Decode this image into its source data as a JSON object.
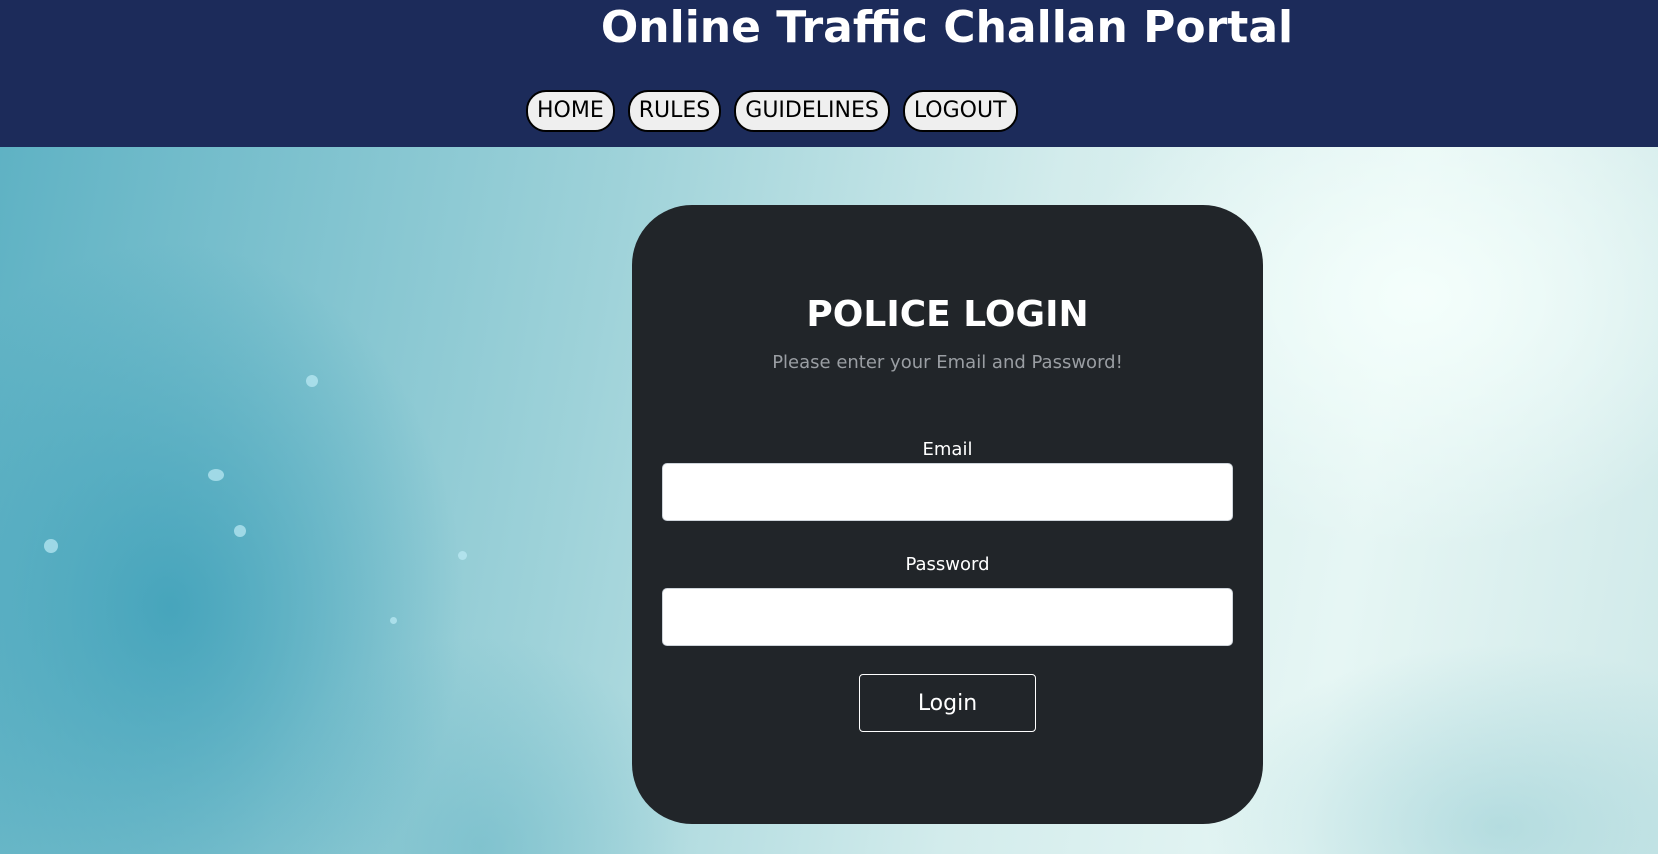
{
  "header": {
    "title": "Online Traffic Challan Portal",
    "nav": [
      {
        "label": "HOME"
      },
      {
        "label": "RULES"
      },
      {
        "label": "GUIDELINES"
      },
      {
        "label": "LOGOUT"
      }
    ]
  },
  "login": {
    "title": "POLICE LOGIN",
    "subtitle": "Please enter your Email and Password!",
    "email_label": "Email",
    "email_value": "",
    "password_label": "Password",
    "password_value": "",
    "submit_label": "Login"
  },
  "colors": {
    "header_bg": "#1c2b5a",
    "card_bg": "#212529",
    "nav_button_bg": "#efefef",
    "subtitle_text": "#9a9ea3"
  }
}
